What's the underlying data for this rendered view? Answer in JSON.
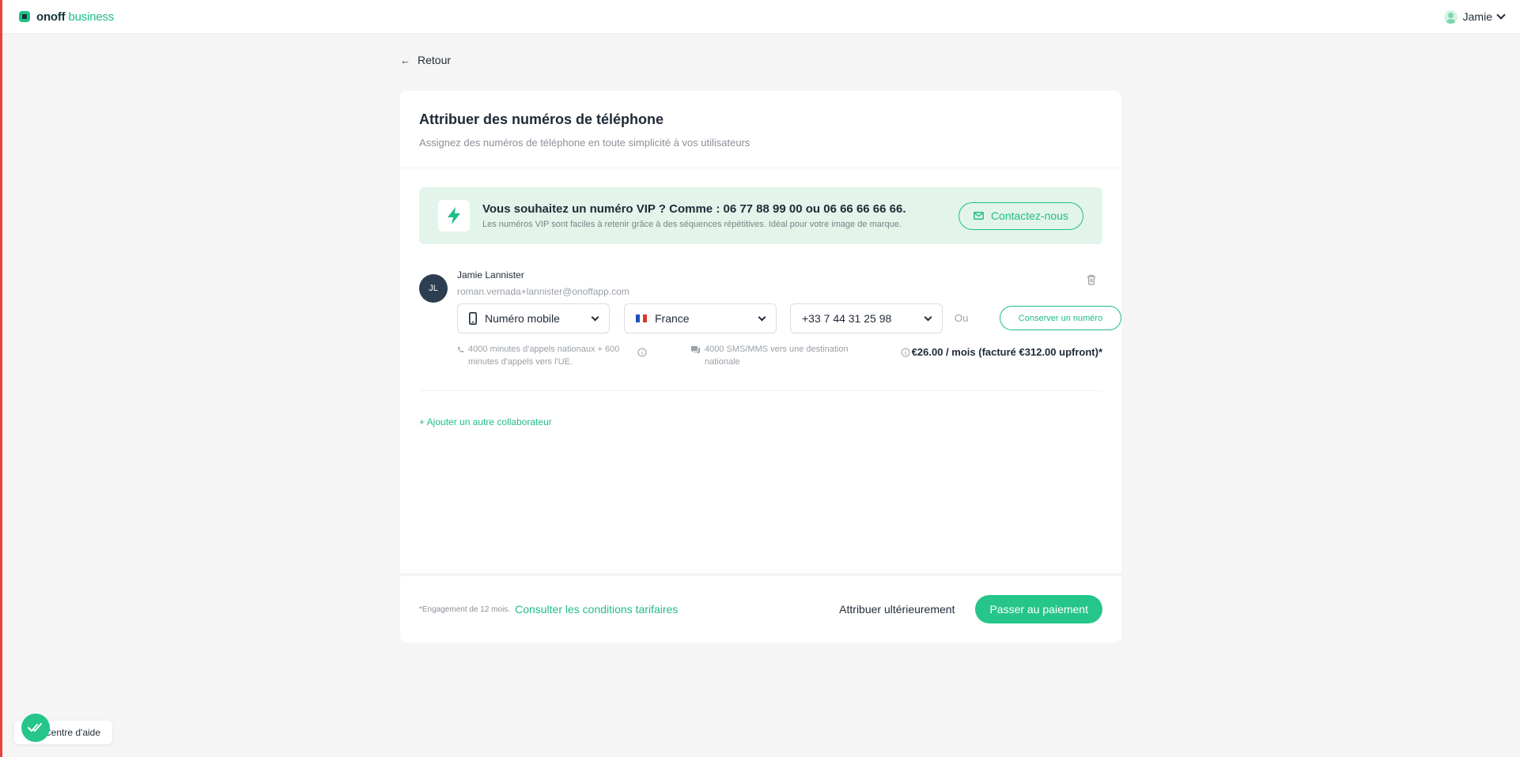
{
  "header": {
    "brand_name": "onoff",
    "brand_suffix": "business",
    "user_name": "Jamie"
  },
  "nav": {
    "back_label": "Retour"
  },
  "page": {
    "title": "Attribuer des numéros de téléphone",
    "subtitle": "Assignez des numéros de téléphone en toute simplicité à vos utilisateurs"
  },
  "vip_banner": {
    "title": "Vous souhaitez un numéro VIP ? Comme : 06 77 88 99 00 ou 06 66 66 66 66.",
    "description": "Les numéros VIP sont faciles à retenir grâce à des séquences répétitives. Idéal pour votre image de marque.",
    "contact_label": "Contactez-nous"
  },
  "assignment": {
    "initials": "JL",
    "name": "Jamie Lannister",
    "email": "roman.vernada+lannister@onoffapp.com",
    "number_type": "Numéro mobile",
    "country": "France",
    "phone_number": "+33 7 44 31 25 98",
    "or_label": "Ou",
    "keep_number_label": "Conserver un numéro",
    "calls_feature": "4000 minutes d'appels nationaux + 600 minutes d'appels vers l'UE.",
    "sms_feature": "4000 SMS/MMS vers une destination nationale",
    "price": "€26.00 / mois (facturé €312.00 upfront)*"
  },
  "add_collaborator_label": "+ Ajouter un autre collaborateur",
  "footer": {
    "engagement_note": "*Engagement de 12 mois.",
    "terms_link": "Consulter les conditions tarifaires",
    "later_label": "Attribuer ultérieurement",
    "pay_label": "Passer au paiement"
  },
  "help_widget": {
    "label": "Centre d'aide"
  },
  "colors": {
    "accent": "#1fbf84",
    "vip_bg": "#e3f4ea",
    "avatar_bg": "#2c3e50",
    "page_bg": "#f4f5f4"
  }
}
